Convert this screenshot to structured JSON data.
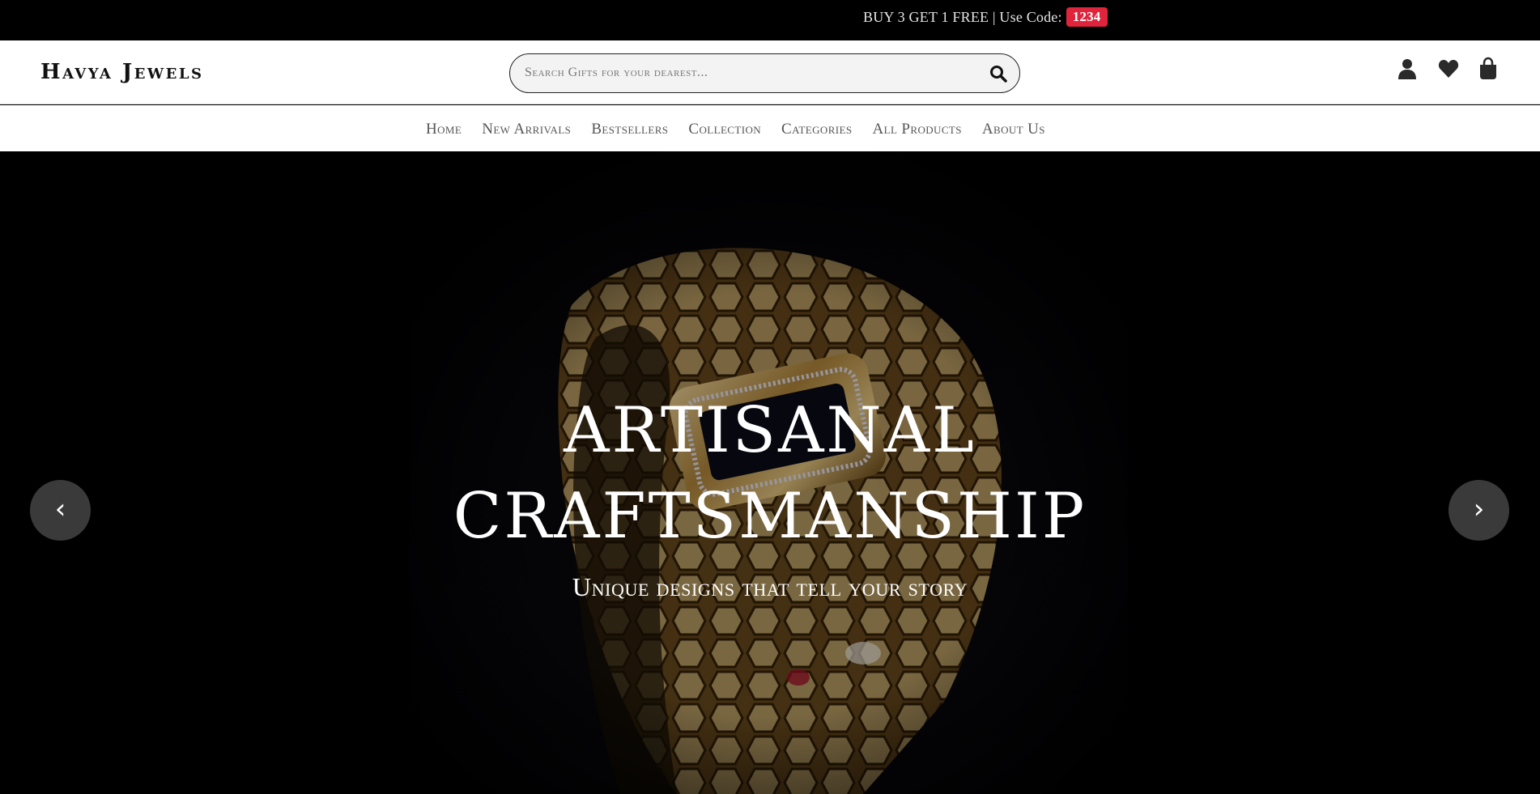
{
  "announcement": {
    "text": "BUY 3 GET 1 FREE | Use Code:",
    "code": "1234"
  },
  "header": {
    "logo": "Havya Jewels",
    "search": {
      "placeholder": "Search Gifts for your dearest...",
      "value": ""
    },
    "icons": [
      "user-icon",
      "heart-icon",
      "shopping-bag-icon"
    ]
  },
  "nav": {
    "items": [
      "Home",
      "New Arrivals",
      "Bestsellers",
      "Collection",
      "Categories",
      "All Products",
      "About Us"
    ]
  },
  "hero": {
    "title_line1": "ARTISANAL",
    "title_line2": "CRAFTSMANSHIP",
    "subtitle": "Unique designs that tell your story",
    "prev_label": "‹",
    "next_label": "›"
  },
  "colors": {
    "announcement_bg": "#000000",
    "badge": "#e0243c",
    "hero_bg": "#000000"
  }
}
